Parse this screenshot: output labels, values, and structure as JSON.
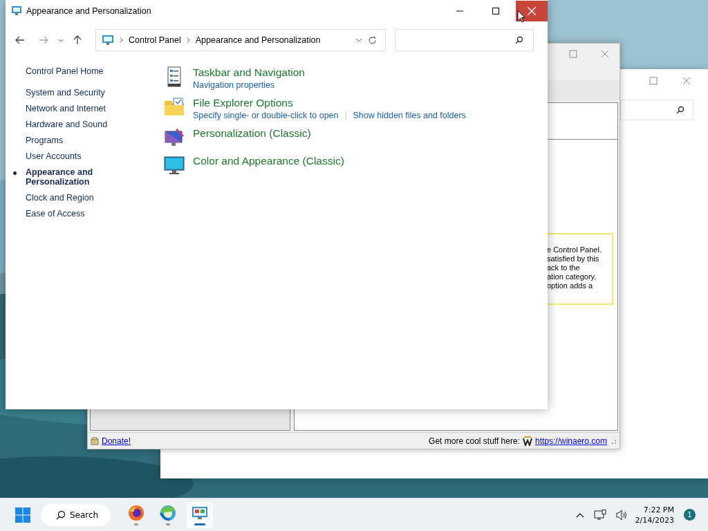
{
  "main_window": {
    "title": "Appearance and Personalization",
    "breadcrumb": [
      "Control Panel",
      "Appearance and Personalization"
    ],
    "sidebar": [
      {
        "label": "Control Panel Home",
        "selected": false,
        "kind": "home"
      },
      {
        "label": "System and Security",
        "selected": false,
        "kind": "item"
      },
      {
        "label": "Network and Internet",
        "selected": false,
        "kind": "item"
      },
      {
        "label": "Hardware and Sound",
        "selected": false,
        "kind": "item"
      },
      {
        "label": "Programs",
        "selected": false,
        "kind": "item"
      },
      {
        "label": "User Accounts",
        "selected": false,
        "kind": "item"
      },
      {
        "label": "Appearance and Personalization",
        "selected": true,
        "kind": "item"
      },
      {
        "label": "Clock and Region",
        "selected": false,
        "kind": "item"
      },
      {
        "label": "Ease of Access",
        "selected": false,
        "kind": "item"
      }
    ],
    "categories": [
      {
        "kind": "taskbar",
        "title": "Taskbar and Navigation",
        "links": [
          "Navigation properties"
        ]
      },
      {
        "kind": "folder",
        "title": "File Explorer Options",
        "links": [
          "Specify single- or double-click to open",
          "Show hidden files and folders"
        ]
      },
      {
        "kind": "personalization",
        "title": "Personalization (Classic)"
      },
      {
        "kind": "color",
        "title": "Color and Appearance (Classic)"
      }
    ]
  },
  "back_window": {
    "hint_lines": [
      "e Control Panel.",
      "satisfied by this",
      "ack to the",
      "ation category.",
      "option adds a"
    ],
    "status_bar": {
      "donate": "Donate!",
      "promo": "Get more cool stuff here:",
      "link": "https://winaero.com"
    }
  },
  "taskbar": {
    "search": "Search",
    "apps": [
      {
        "kind": "firefox",
        "active": false
      },
      {
        "kind": "edge",
        "active": false
      },
      {
        "kind": "control-panel",
        "active": true
      }
    ],
    "time": "7:22 PM",
    "date": "2/14/2023",
    "notifications": "1"
  }
}
